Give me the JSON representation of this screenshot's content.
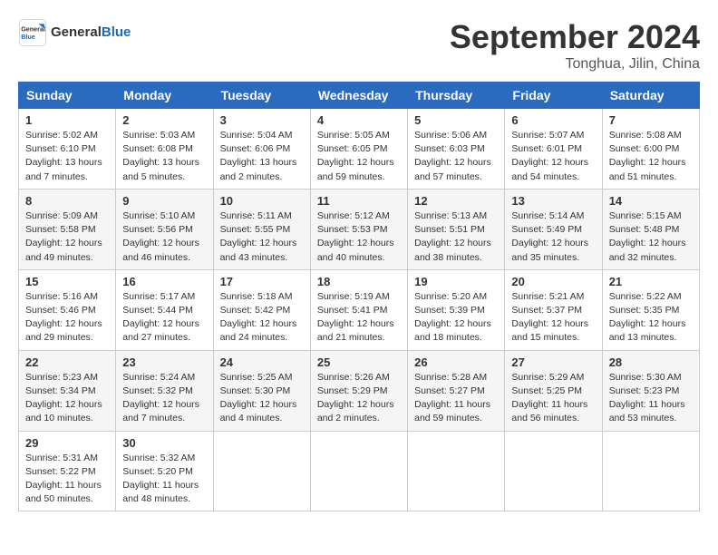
{
  "header": {
    "logo_general": "General",
    "logo_blue": "Blue",
    "month_title": "September 2024",
    "subtitle": "Tonghua, Jilin, China"
  },
  "days_of_week": [
    "Sunday",
    "Monday",
    "Tuesday",
    "Wednesday",
    "Thursday",
    "Friday",
    "Saturday"
  ],
  "weeks": [
    [
      {
        "day": "1",
        "info": "Sunrise: 5:02 AM\nSunset: 6:10 PM\nDaylight: 13 hours\nand 7 minutes."
      },
      {
        "day": "2",
        "info": "Sunrise: 5:03 AM\nSunset: 6:08 PM\nDaylight: 13 hours\nand 5 minutes."
      },
      {
        "day": "3",
        "info": "Sunrise: 5:04 AM\nSunset: 6:06 PM\nDaylight: 13 hours\nand 2 minutes."
      },
      {
        "day": "4",
        "info": "Sunrise: 5:05 AM\nSunset: 6:05 PM\nDaylight: 12 hours\nand 59 minutes."
      },
      {
        "day": "5",
        "info": "Sunrise: 5:06 AM\nSunset: 6:03 PM\nDaylight: 12 hours\nand 57 minutes."
      },
      {
        "day": "6",
        "info": "Sunrise: 5:07 AM\nSunset: 6:01 PM\nDaylight: 12 hours\nand 54 minutes."
      },
      {
        "day": "7",
        "info": "Sunrise: 5:08 AM\nSunset: 6:00 PM\nDaylight: 12 hours\nand 51 minutes."
      }
    ],
    [
      {
        "day": "8",
        "info": "Sunrise: 5:09 AM\nSunset: 5:58 PM\nDaylight: 12 hours\nand 49 minutes."
      },
      {
        "day": "9",
        "info": "Sunrise: 5:10 AM\nSunset: 5:56 PM\nDaylight: 12 hours\nand 46 minutes."
      },
      {
        "day": "10",
        "info": "Sunrise: 5:11 AM\nSunset: 5:55 PM\nDaylight: 12 hours\nand 43 minutes."
      },
      {
        "day": "11",
        "info": "Sunrise: 5:12 AM\nSunset: 5:53 PM\nDaylight: 12 hours\nand 40 minutes."
      },
      {
        "day": "12",
        "info": "Sunrise: 5:13 AM\nSunset: 5:51 PM\nDaylight: 12 hours\nand 38 minutes."
      },
      {
        "day": "13",
        "info": "Sunrise: 5:14 AM\nSunset: 5:49 PM\nDaylight: 12 hours\nand 35 minutes."
      },
      {
        "day": "14",
        "info": "Sunrise: 5:15 AM\nSunset: 5:48 PM\nDaylight: 12 hours\nand 32 minutes."
      }
    ],
    [
      {
        "day": "15",
        "info": "Sunrise: 5:16 AM\nSunset: 5:46 PM\nDaylight: 12 hours\nand 29 minutes."
      },
      {
        "day": "16",
        "info": "Sunrise: 5:17 AM\nSunset: 5:44 PM\nDaylight: 12 hours\nand 27 minutes."
      },
      {
        "day": "17",
        "info": "Sunrise: 5:18 AM\nSunset: 5:42 PM\nDaylight: 12 hours\nand 24 minutes."
      },
      {
        "day": "18",
        "info": "Sunrise: 5:19 AM\nSunset: 5:41 PM\nDaylight: 12 hours\nand 21 minutes."
      },
      {
        "day": "19",
        "info": "Sunrise: 5:20 AM\nSunset: 5:39 PM\nDaylight: 12 hours\nand 18 minutes."
      },
      {
        "day": "20",
        "info": "Sunrise: 5:21 AM\nSunset: 5:37 PM\nDaylight: 12 hours\nand 15 minutes."
      },
      {
        "day": "21",
        "info": "Sunrise: 5:22 AM\nSunset: 5:35 PM\nDaylight: 12 hours\nand 13 minutes."
      }
    ],
    [
      {
        "day": "22",
        "info": "Sunrise: 5:23 AM\nSunset: 5:34 PM\nDaylight: 12 hours\nand 10 minutes."
      },
      {
        "day": "23",
        "info": "Sunrise: 5:24 AM\nSunset: 5:32 PM\nDaylight: 12 hours\nand 7 minutes."
      },
      {
        "day": "24",
        "info": "Sunrise: 5:25 AM\nSunset: 5:30 PM\nDaylight: 12 hours\nand 4 minutes."
      },
      {
        "day": "25",
        "info": "Sunrise: 5:26 AM\nSunset: 5:29 PM\nDaylight: 12 hours\nand 2 minutes."
      },
      {
        "day": "26",
        "info": "Sunrise: 5:28 AM\nSunset: 5:27 PM\nDaylight: 11 hours\nand 59 minutes."
      },
      {
        "day": "27",
        "info": "Sunrise: 5:29 AM\nSunset: 5:25 PM\nDaylight: 11 hours\nand 56 minutes."
      },
      {
        "day": "28",
        "info": "Sunrise: 5:30 AM\nSunset: 5:23 PM\nDaylight: 11 hours\nand 53 minutes."
      }
    ],
    [
      {
        "day": "29",
        "info": "Sunrise: 5:31 AM\nSunset: 5:22 PM\nDaylight: 11 hours\nand 50 minutes."
      },
      {
        "day": "30",
        "info": "Sunrise: 5:32 AM\nSunset: 5:20 PM\nDaylight: 11 hours\nand 48 minutes."
      },
      {
        "day": "",
        "info": ""
      },
      {
        "day": "",
        "info": ""
      },
      {
        "day": "",
        "info": ""
      },
      {
        "day": "",
        "info": ""
      },
      {
        "day": "",
        "info": ""
      }
    ]
  ]
}
